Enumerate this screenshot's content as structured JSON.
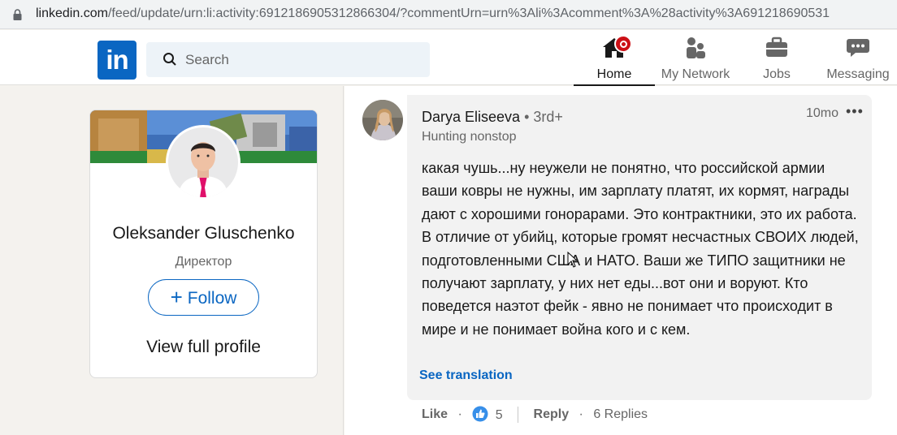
{
  "browser": {
    "url_host": "linkedin.com",
    "url_path": "/feed/update/urn:li:activity:6912186905312866304/?commentUrn=urn%3Ali%3Acomment%3A%28activity%3A691218690531"
  },
  "nav": {
    "logo_text": "in",
    "search_placeholder": "Search",
    "items": [
      {
        "label": "Home",
        "icon": "home-icon",
        "active": true
      },
      {
        "label": "My Network",
        "icon": "network-icon",
        "active": false
      },
      {
        "label": "Jobs",
        "icon": "jobs-icon",
        "active": false
      },
      {
        "label": "Messaging",
        "icon": "messaging-icon",
        "active": false
      }
    ],
    "brand_color": "#0a66c2"
  },
  "profile": {
    "name": "Oleksander Gluschenko",
    "title": "Директор",
    "follow_label": "Follow",
    "view_profile_label": "View full profile"
  },
  "comment": {
    "author": "Darya Eliseeva",
    "degree": "3rd+",
    "headline": "Hunting nonstop",
    "time": "10mo",
    "more": "•••",
    "text": "какая чушь...ну неужели не понятно, что российской армии ваши ковры не нужны, им зарплату платят, их кормят, награды дают с хорошими гонорарами. Это контрактники, это их работа. В отличие от убийц, которые громят несчастных СВОИХ людей, подготовленными США и НАТО. Ваши же ТИПО защитники не получают зарплату, у них нет еды...вот они и воруют. Кто поведется наэтот фейк - явно не понимает что происходит в мире и не понимает война кого и с кем.",
    "see_translation": "See translation",
    "like_label": "Like",
    "reaction_count": "5",
    "reply_label": "Reply",
    "replies": "6 Replies"
  }
}
